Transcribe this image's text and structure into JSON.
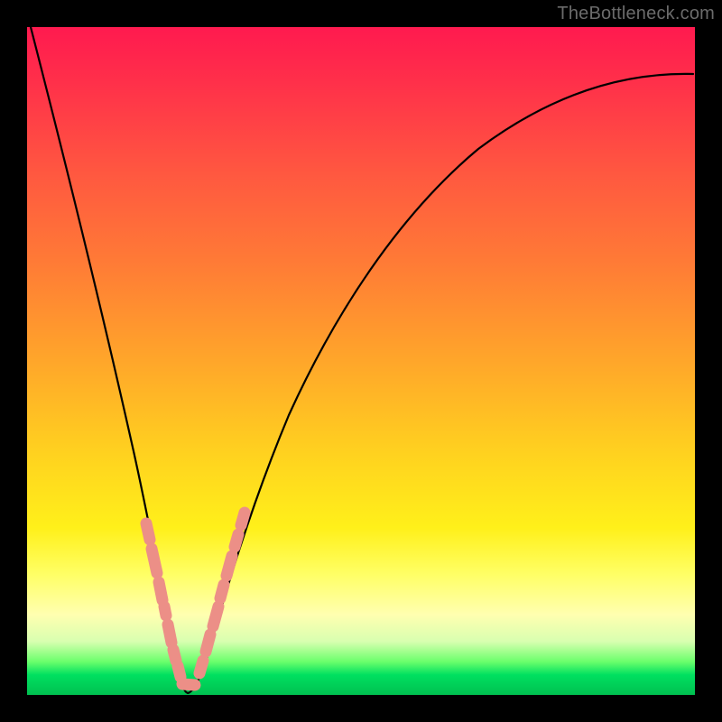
{
  "watermark": "TheBottleneck.com",
  "accent_colors": {
    "bead": "#ec8f87",
    "curve": "#000000",
    "gradient_top": "#ff1a4f",
    "gradient_bottom": "#00c050"
  },
  "chart_data": {
    "type": "line",
    "title": "",
    "xlabel": "",
    "ylabel": "",
    "xlim": [
      0,
      100
    ],
    "ylim": [
      0,
      100
    ],
    "grid": false,
    "legend": false,
    "annotations": [
      "TheBottleneck.com"
    ],
    "series": [
      {
        "name": "bottleneck-curve",
        "x": [
          0,
          2,
          4,
          6,
          8,
          10,
          12,
          14,
          16,
          18,
          20,
          21,
          22,
          23,
          24,
          26,
          28,
          30,
          33,
          36,
          40,
          45,
          50,
          55,
          60,
          66,
          73,
          80,
          88,
          95,
          100
        ],
        "y": [
          100,
          92,
          84,
          76,
          68,
          60,
          51,
          42,
          33,
          24,
          14,
          9,
          4,
          1,
          0,
          2,
          6,
          12,
          20,
          28,
          37,
          47,
          55,
          62,
          68,
          74,
          80,
          84,
          88,
          91,
          93
        ]
      }
    ],
    "highlighted_points": {
      "comment": "Nominal x positions along the curve where salmon bead markers appear near the valley of the V",
      "x": [
        17.5,
        18.6,
        19.4,
        19.9,
        20.7,
        21.3,
        21.9,
        22.7,
        23.5,
        24.5,
        25.3,
        26.2,
        26.8,
        27.4,
        28.1,
        28.8,
        29.6,
        30.3,
        31.2
      ]
    },
    "valley_x": 24,
    "description": "V-shaped bottleneck curve over a red-to-green vertical gradient. Minimum (optimal/no-bottleneck) occurs near x≈24% of the horizontal range. Salmon-colored rounded markers sit along both arms of the V near the trough."
  }
}
